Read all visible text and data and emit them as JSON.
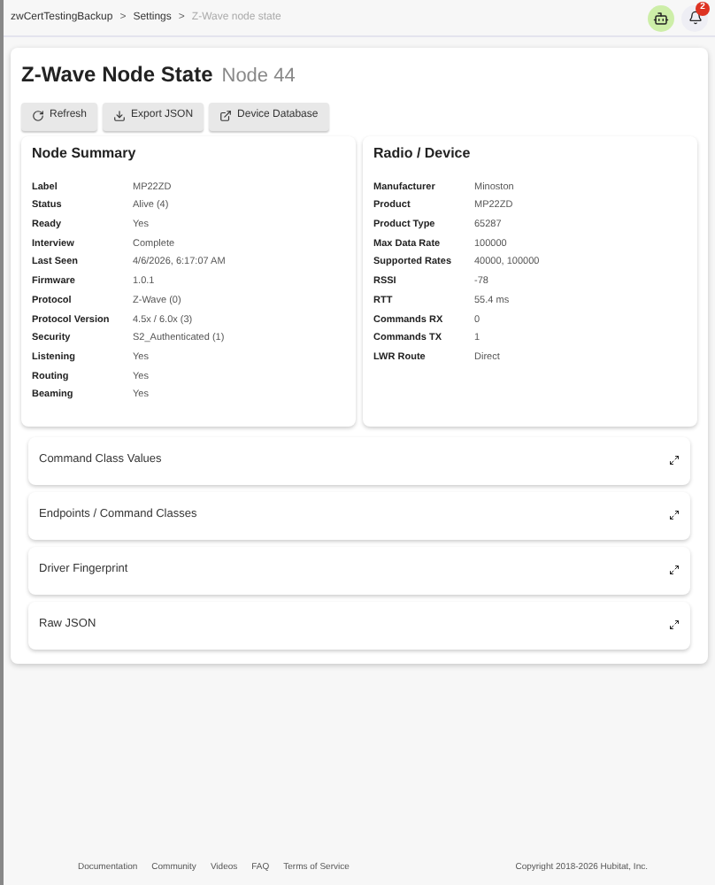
{
  "breadcrumbs": [
    {
      "label": "zwCertTestingBackup",
      "current": false
    },
    {
      "label": "Settings",
      "current": false
    },
    {
      "label": "Z-Wave node state",
      "current": true
    }
  ],
  "separator": ">",
  "notifications": {
    "count": "2"
  },
  "header": {
    "title": "Z-Wave Node State",
    "subtitle": "Node 44"
  },
  "buttons": [
    {
      "label": "Refresh",
      "kind": "refresh"
    },
    {
      "label": "Export JSON",
      "kind": "export"
    },
    {
      "label": "Device Database",
      "kind": "external"
    }
  ],
  "panels": [
    {
      "title": "Node Summary",
      "rows": [
        {
          "label": "Label",
          "value": "MP22ZD"
        },
        {
          "label": "Status",
          "value": "Alive (4)"
        },
        {
          "label": "Ready",
          "value": "Yes"
        },
        {
          "label": "Interview",
          "value": "Complete"
        },
        {
          "label": "Last Seen",
          "value": "4/6/2026, 6:17:07 AM"
        },
        {
          "label": "Firmware",
          "value": "1.0.1"
        },
        {
          "label": "Protocol",
          "value": "Z-Wave (0)"
        },
        {
          "label": "Protocol Version",
          "value": "4.5x / 6.0x (3)"
        },
        {
          "label": "Security",
          "value": "S2_Authenticated (1)"
        },
        {
          "label": "Listening",
          "value": "Yes"
        },
        {
          "label": "Routing",
          "value": "Yes"
        },
        {
          "label": "Beaming",
          "value": "Yes"
        }
      ]
    },
    {
      "title": "Radio / Device",
      "rows": [
        {
          "label": "Manufacturer",
          "value": "Minoston"
        },
        {
          "label": "Product",
          "value": "MP22ZD"
        },
        {
          "label": "Product Type",
          "value": "65287"
        },
        {
          "label": "Max Data Rate",
          "value": "100000"
        },
        {
          "label": "Supported Rates",
          "value": "40000, 100000"
        },
        {
          "label": "RSSI",
          "value": "-78"
        },
        {
          "label": "RTT",
          "value": "55.4 ms"
        },
        {
          "label": "Commands RX",
          "value": "0"
        },
        {
          "label": "Commands TX",
          "value": "1"
        },
        {
          "label": "LWR Route",
          "value": "Direct"
        }
      ]
    }
  ],
  "sections": [
    {
      "title": "Command Class Values",
      "expanded": false
    },
    {
      "title": "Endpoints / Command Classes",
      "expanded": false
    },
    {
      "title": "Driver Fingerprint",
      "expanded": false
    },
    {
      "title": "Raw JSON",
      "expanded": false
    }
  ],
  "footer": {
    "links": [
      "Documentation",
      "Community",
      "Videos",
      "FAQ",
      "Terms of Service"
    ],
    "copyright": "Copyright 2018-2026 Hubitat, Inc."
  }
}
